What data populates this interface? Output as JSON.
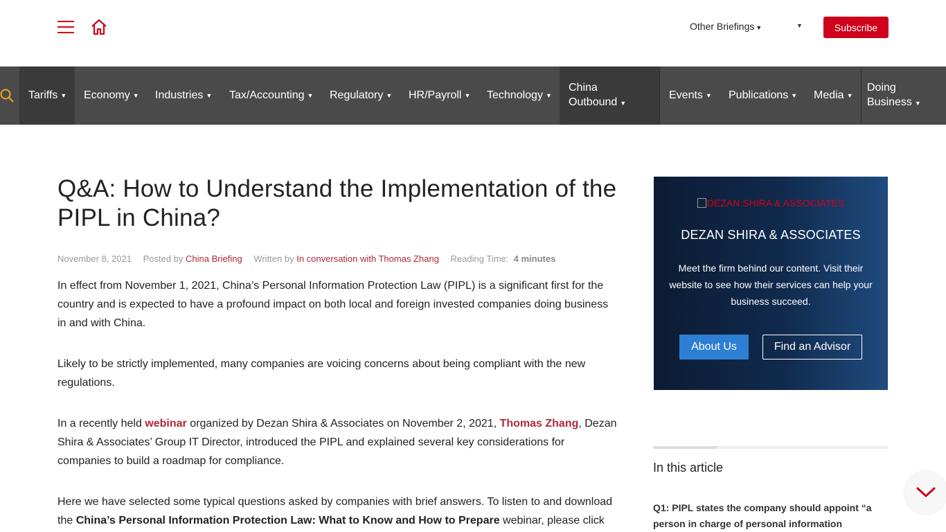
{
  "header": {
    "menu_icon": "hamburger-menu-icon",
    "home_icon": "home-icon",
    "other_briefings": "Other Briefings",
    "subscribe": "Subscribe",
    "accent_color": "#d0021b"
  },
  "nav": {
    "search_icon": "search-icon",
    "items": [
      {
        "label": "Tariffs"
      },
      {
        "label": "Economy"
      },
      {
        "label": "Industries"
      },
      {
        "label": "Tax/Accounting"
      },
      {
        "label": "Regulatory"
      },
      {
        "label": "HR/Payroll"
      },
      {
        "label": "Technology"
      },
      {
        "label": "China Outbound"
      },
      {
        "label": "Events"
      },
      {
        "label": "Publications"
      },
      {
        "label": "Media"
      },
      {
        "label": "Doing Business"
      }
    ]
  },
  "article": {
    "title": "Q&A: How to Understand the Implementation of the PIPL in China?",
    "date": "November 8, 2021",
    "posted_by_label": "Posted by",
    "posted_by": "China Briefing",
    "written_by_label": "Written by",
    "written_by": "In conversation with Thomas Zhang",
    "reading_time_label": "Reading Time:",
    "reading_time": "4 minutes",
    "p1": "In effect from November 1, 2021, China’s Personal Information Protection Law (PIPL) is a significant first for the country and is expected to have a profound impact on both local and foreign invested companies doing business in and with China.",
    "p2": "Likely to be strictly implemented, many companies are voicing concerns about being compliant with the new regulations.",
    "p3_a": "In a recently held ",
    "p3_link1": "webinar",
    "p3_b": " organized by Dezan Shira & Associates on November 2, 2021, ",
    "p3_link2": "Thomas Zhang",
    "p3_c": ", Dezan Shira & Associates’ Group IT Director, introduced the PIPL and explained several key considerations for companies to build a roadmap for compliance.",
    "p4_a": "Here we have selected some typical questions asked by companies with brief answers. To listen to and download the ",
    "p4_bold": "China’s Personal Information Protection Law: What to Know and How to Prepare",
    "p4_b": " webinar, please click"
  },
  "sidebar": {
    "logo_alt": "DEZAN SHIRA & ASSOCIATES",
    "title": "DEZAN SHIRA & ASSOCIATES",
    "description": "Meet the firm behind our content. Visit their website to see how their services can help your business succeed.",
    "about_button": "About Us",
    "advisor_button": "Find an Advisor",
    "toc_heading": "In this article",
    "toc_progress": 0.27,
    "toc_first_item": "Q1: PIPL states the company should appoint “a person in charge of personal information"
  },
  "scroll_icon": "chevron-down-icon"
}
